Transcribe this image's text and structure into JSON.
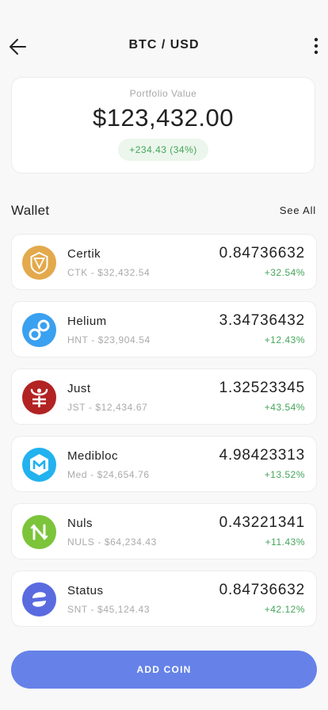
{
  "header": {
    "title": "BTC / USD",
    "back_icon": "arrow-left-icon",
    "more_icon": "more-vertical-icon"
  },
  "portfolio": {
    "label": "Portfolio Value",
    "value": "$123,432.00",
    "change": "+234.43 (34%)"
  },
  "wallet": {
    "title": "Wallet",
    "see_all": "See All",
    "coins": [
      {
        "name": "Certik",
        "sub": "CTK - $32,432.54",
        "amount": "0.84736632",
        "pct": "+32.54%",
        "icon": "certik-icon",
        "color": "#e3a94c"
      },
      {
        "name": "Helium",
        "sub": "HNT - $23,904.54",
        "amount": "3.34736432",
        "pct": "+12.43%",
        "icon": "helium-icon",
        "color": "#3aa0f0"
      },
      {
        "name": "Just",
        "sub": "JST - $12,434.67",
        "amount": "1.32523345",
        "pct": "+43.54%",
        "icon": "just-icon",
        "color": "#b22323"
      },
      {
        "name": "Medibloc",
        "sub": "Med - $24,654.76",
        "amount": "4.98423313",
        "pct": "+13.52%",
        "icon": "medibloc-icon",
        "color": "#22b2ef"
      },
      {
        "name": "Nuls",
        "sub": "NULS - $64,234.43",
        "amount": "0.43221341",
        "pct": "+11.43%",
        "icon": "nuls-icon",
        "color": "#7cc43a"
      },
      {
        "name": "Status",
        "sub": "SNT - $45,124.43",
        "amount": "0.84736632",
        "pct": "+42.12%",
        "icon": "status-icon",
        "color": "#5a6bdf"
      }
    ]
  },
  "actions": {
    "add_coin": "ADD COIN"
  },
  "colors": {
    "accent": "#6682e9",
    "positive": "#44a55a",
    "positive_bg": "#ecf6ec"
  }
}
